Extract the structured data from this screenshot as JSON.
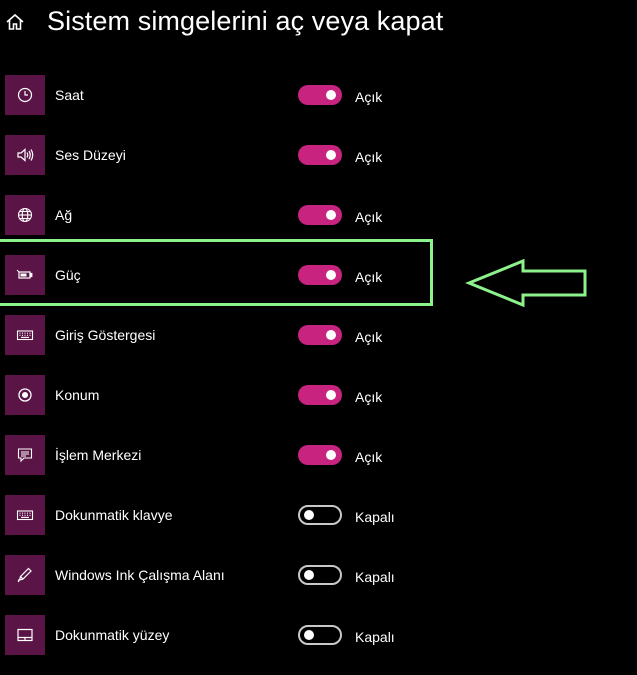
{
  "header": {
    "title": "Sistem simgelerini aç veya kapat",
    "home_icon": "home-icon"
  },
  "colors": {
    "accent": "#c8237f",
    "tile": "#5a1446",
    "highlight": "#8cf28c"
  },
  "items": [
    {
      "label": "Saat",
      "icon": "clock-icon",
      "state": "Açık",
      "on": true
    },
    {
      "label": "Ses Düzeyi",
      "icon": "speaker-icon",
      "state": "Açık",
      "on": true
    },
    {
      "label": "Ağ",
      "icon": "globe-icon",
      "state": "Açık",
      "on": true
    },
    {
      "label": "Güç",
      "icon": "battery-icon",
      "state": "Açık",
      "on": true
    },
    {
      "label": "Giriş Göstergesi",
      "icon": "keyboard-icon",
      "state": "Açık",
      "on": true
    },
    {
      "label": "Konum",
      "icon": "location-icon",
      "state": "Açık",
      "on": true
    },
    {
      "label": "İşlem Merkezi",
      "icon": "action-center-icon",
      "state": "Açık",
      "on": true
    },
    {
      "label": "Dokunmatik klavye",
      "icon": "touch-keyboard-icon",
      "state": "Kapalı",
      "on": false
    },
    {
      "label": "Windows Ink Çalışma Alanı",
      "icon": "pen-icon",
      "state": "Kapalı",
      "on": false
    },
    {
      "label": "Dokunmatik yüzey",
      "icon": "touchpad-icon",
      "state": "Kapalı",
      "on": false
    }
  ]
}
